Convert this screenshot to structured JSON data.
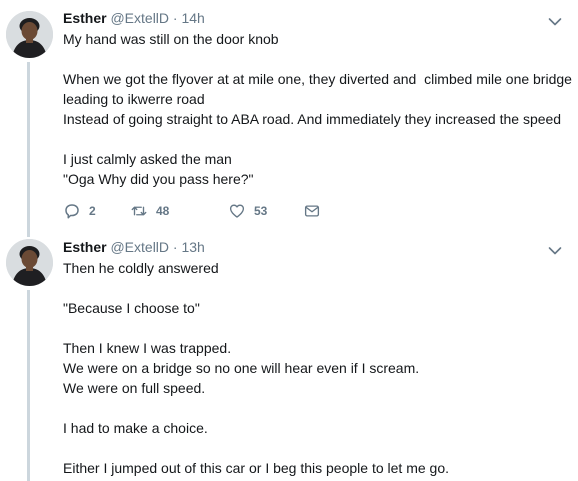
{
  "tweets": [
    {
      "name": "Esther",
      "handle": "@ExtellD",
      "dot": "·",
      "time": "14h",
      "text": "My hand was still on the door knob\n\nWhen we got the flyover at at mile one, they diverted and  climbed mile one bridge leading to ikwerre road\nInstead of going straight to ABA road. And immediately they increased the speed\n\nI just calmly asked the man\n\"Oga Why did you pass here?\"",
      "replies": "2",
      "retweets": "48",
      "likes": "53"
    },
    {
      "name": "Esther",
      "handle": "@ExtellD",
      "dot": "·",
      "time": "13h",
      "text": "Then he coldly answered\n\n\"Because I choose to\"\n\nThen I knew I was trapped.\nWe were on a bridge so no one will hear even if I scream.\nWe were on full speed.\n\nI had to make a choice.\n\nEither I jumped out of this car or I beg this people to let me go."
    }
  ],
  "colors": {
    "text": "#14171a",
    "secondary": "#657786",
    "thread_line": "#ccd6dd"
  },
  "icons": {
    "reply": "reply-icon",
    "retweet": "retweet-icon",
    "like": "heart-icon",
    "dm": "envelope-icon",
    "menu": "chevron-down-icon"
  }
}
